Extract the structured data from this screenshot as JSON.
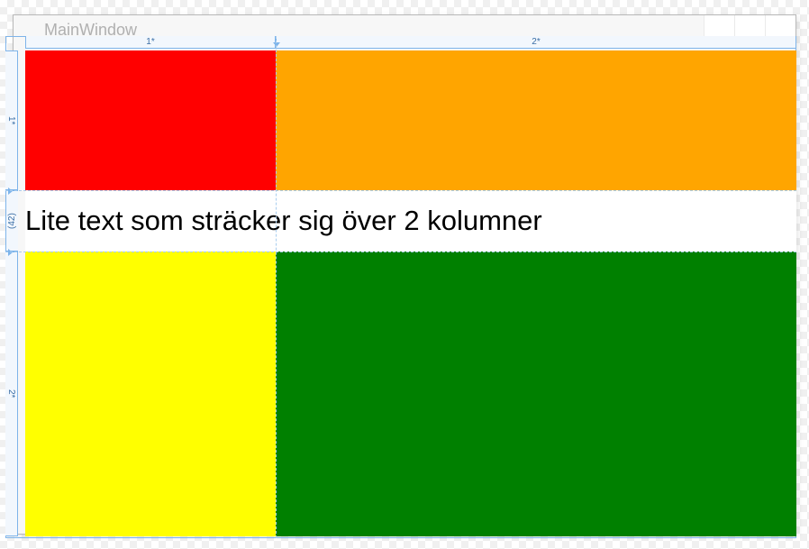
{
  "window": {
    "title": "MainWindow"
  },
  "rulers": {
    "col1": "1*",
    "col2": "2*",
    "row1": "1*",
    "row2": "(42)",
    "row3": "2*"
  },
  "grid": {
    "span_text": "Lite text som sträcker sig över 2 kolumner"
  },
  "colors": {
    "red": "#ff0000",
    "orange": "#ffa500",
    "yellow": "#ffff00",
    "green": "#008000",
    "selection": "#7eb4ea"
  }
}
